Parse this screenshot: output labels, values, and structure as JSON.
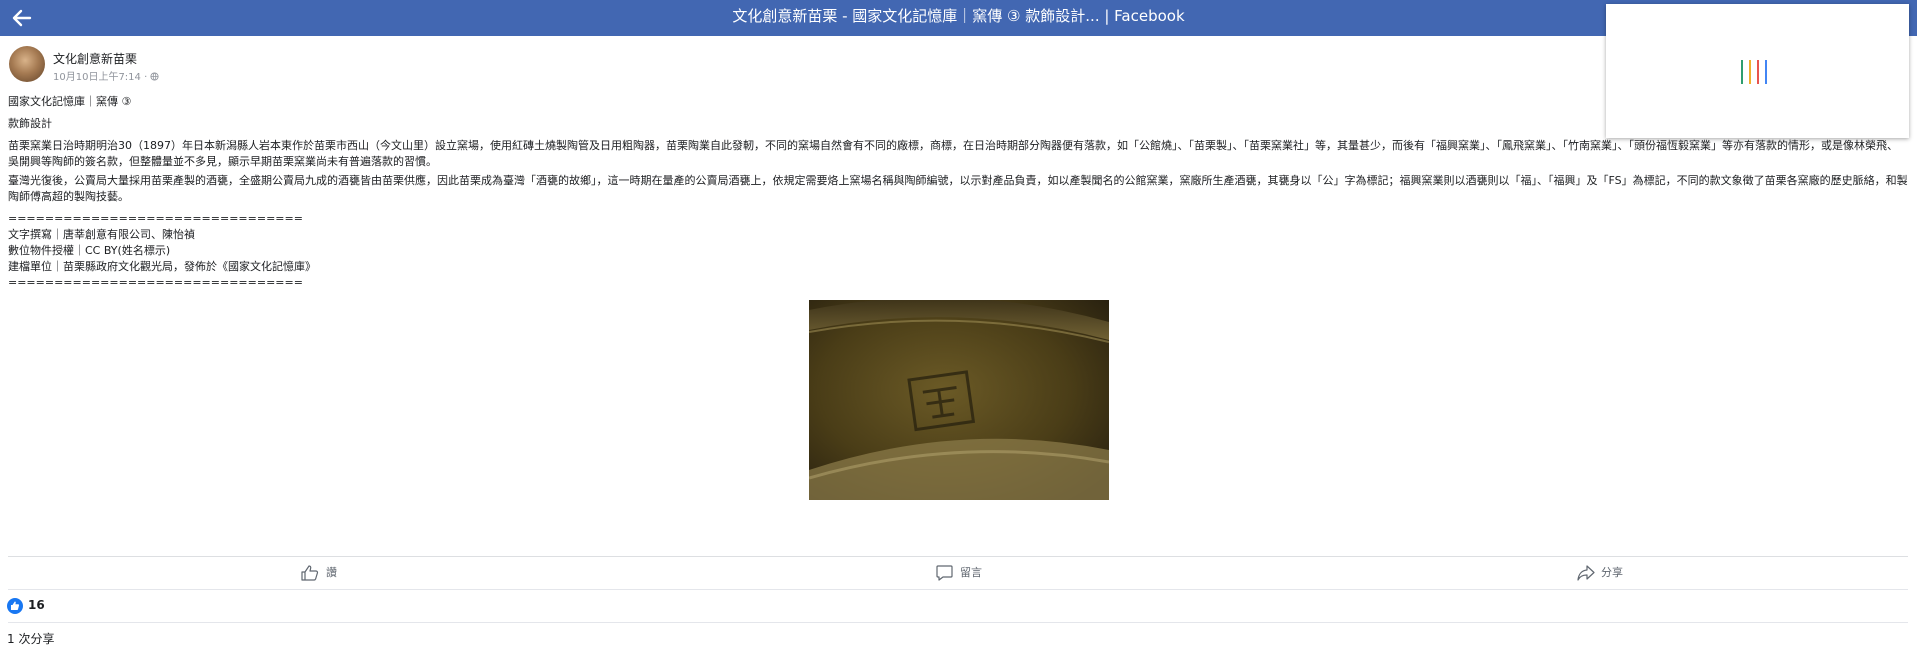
{
  "header": {
    "title": "文化創意新苗栗 - 國家文化記憶庫｜窯傳 ③ 款飾設計... | Facebook",
    "background": "#4267b2"
  },
  "post": {
    "author": "文化創意新苗栗",
    "timestamp": "10月10日上午7:14",
    "body": [
      "國家文化記憶庫｜窯傳 ③",
      "款飾設計",
      "苗栗窯業日治時期明治30（1897）年日本新潟縣人岩本東作於苗栗市西山（今文山里）設立窯場，使用紅磚土燒製陶管及日用粗陶器，苗栗陶業自此發軔，不同的窯場自然會有不同的廠標，商標，在日治時期部分陶器便有落款，如「公館燒」、「苗栗製」、「苗栗窯業社」等，其量甚少，而後有「福興窯業」、「鳳飛窯業」、「竹南窯業」、「頭份福恆毅窯業」等亦有落款的情形，或是像林榮飛、吳開興等陶師的簽名款，但整體量並不多見，顯示早期苗栗窯業尚未有普遍落款的習慣。",
      "臺灣光復後，公賣局大量採用苗栗產製的酒甕，全盛期公賣局九成的酒甕皆由苗栗供應，因此苗栗成為臺灣「酒甕的故鄉」，這一時期在量產的公賣局酒甕上，依規定需要烙上窯場名稱與陶師編號，以示對產品負責，如以產製聞名的公館窯業，窯廠所生產酒甕，其甕身以「公」字為標記；福興窯業則以酒甕則以「福」、「福興」及「FS」為標記，不同的款文象徵了苗栗各窯廠的歷史脈絡，和製陶師傅高超的製陶技藝。",
      "================================",
      "文字撰寫｜唐莘創意有限公司、陳怡禎",
      "數位物件授權｜CC BY(姓名標示)",
      "建檔單位｜苗栗縣政府文化觀光局，發佈於《國家文化記憶庫》",
      "================================"
    ]
  },
  "actions": {
    "like_label": "讚",
    "comment_label": "留言",
    "share_label": "分享"
  },
  "stats": {
    "like_count": "16",
    "share_count": "1 次分享"
  },
  "colors": {
    "facebook_blue": "#4267b2",
    "like_blue": "#1877f2",
    "loader_bars": [
      "#2f9e6f",
      "#f2b12c",
      "#e8554e",
      "#4285f4"
    ]
  }
}
